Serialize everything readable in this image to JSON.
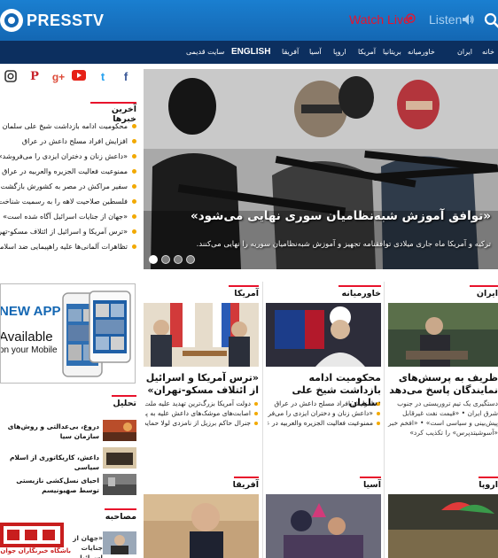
{
  "header": {
    "logo_text": "PRESSTV",
    "watch_live": "Watch Live",
    "listen": "Listen"
  },
  "nav": [
    "خانه",
    "ایران",
    "خاورمیانه",
    "بریتانیا",
    "آمریکا",
    "اروپا",
    "آسیا",
    "آفریقا",
    "ENGLISH",
    "سایت قدیمی"
  ],
  "social_icons": [
    "instagram-icon",
    "pinterest-icon",
    "google-plus-icon",
    "youtube-icon",
    "twitter-icon",
    "facebook-icon"
  ],
  "hero": {
    "title": "«توافق آموزش شبه‌نظامیان سوری نهایی می‌شود»",
    "subtitle": "ترکیه و آمریکا ماه جاری میلادی توافقنامه تجهیز و آموزش شبه‌نظامیان سوریه را نهایی می‌کنند.",
    "slide_count": 4,
    "active_slide": 1
  },
  "latest": {
    "heading": "آخرین خبرها",
    "items": [
      "محکومیت ادامه بازداشت شیخ علی سلمان",
      "افزایش افراد مسلح داعش در عراق",
      "«داعش زنان و دختران ایزدی را می‌فروشد»",
      "ممنوعیت فعالیت الجزیره والعربیه در عراق",
      "سفیر مراکش در مصر به کشورش بازگشت",
      "فلسطین صلاحیت لاهه را به رسمیت شناخت",
      "«جهان از جنایات اسرائیل آگاه شده است»",
      "«ترس آمریکا و اسرائیل از ائتلاف مسکو-تهران»",
      "تظاهرات آلمانی‌ها علیه راهپیمایی ضد اسلامی"
    ]
  },
  "app_banner": {
    "line1": "NEW APP",
    "line2": "Available",
    "line3": "on your Mobile"
  },
  "tahlil": {
    "heading": "تحلیل",
    "items": [
      "دروغ، بی‌عدالتی و روش‌های سازمان سیا",
      "داعش، کاریکاتوری از اسلام سیاسی",
      "احیای نسل‌کشی نازیستی توسط صهیونیسم"
    ]
  },
  "interview": {
    "heading": "مصاحبه",
    "item": "«جهان از جنایات اسرائیل آگاه شده است»"
  },
  "cards": {
    "america": {
      "heading": "آمریکا",
      "title": "«ترس آمریکا و اسرائیل از ائتلاف مسکو-تهران»",
      "bullets": [
        "دولت آمریکا بزرگ‌ترین تهدید علیه ملت ایران",
        "اصابت‌های موشک‌های داعش علیه به پایگاهی عراقی",
        "جنرال حاکم برزیل از نامزدی لولا حمایت می‌کند"
      ]
    },
    "middle_east": {
      "heading": "خاورمیانه",
      "title": "محکومیت ادامه بازداشت شیخ علی سلمان",
      "bullets": [
        "افزایش افراد مسلح داعش در عراق",
        "«داعش زنان و دختران ایزدی را می‌فروشد»",
        "ممنوعیت فعالیت الجزیره والعربیه در عراق"
      ]
    },
    "iran": {
      "heading": "ایران",
      "title": "ظریف به پرسش‌های نمایندگان پاسخ می‌دهد",
      "text": "دستگیری یک تیم تروریستی در جنوب شرق ایران • «قیمت نفت غیرقابل پیش‌بینی و سیاسی است» • «افخم خبر «آسوشیتدپرس» را تکذیب کرد»"
    },
    "africa": {
      "heading": "آفریقا"
    },
    "asia": {
      "heading": "آسیا"
    },
    "europe": {
      "heading": "اروپا"
    }
  },
  "watermark": "باشگاه خبرنگاران جوان",
  "colors": {
    "header_blue": "#1467b3",
    "nav_navy": "#0c2f5f",
    "live_red": "#e8132c",
    "bullet_orange": "#f2a900"
  }
}
